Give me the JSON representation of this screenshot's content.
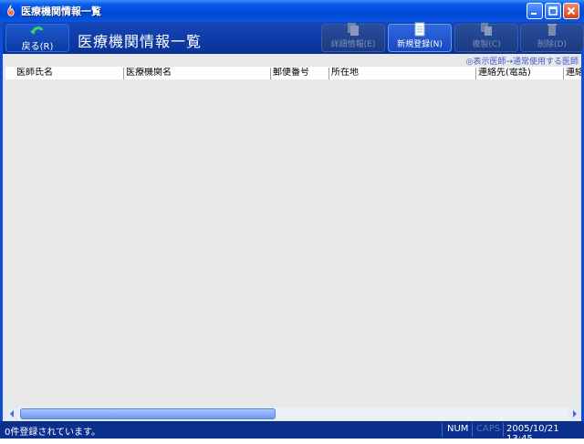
{
  "window": {
    "title": "医療機関情報一覧"
  },
  "toolbar": {
    "back_label": "戻る(R)",
    "page_title": "医療機関情報一覧",
    "details_label": "詳細情報(E)",
    "new_label": "新規登録(N)",
    "copy_label": "複製(C)",
    "delete_label": "削除(D)"
  },
  "note": "◎表示医師→通常使用する医師",
  "table": {
    "columns": [
      "医師氏名",
      "医療機関名",
      "郵便番号",
      "所在地",
      "連絡先(電話)",
      "連絡"
    ],
    "rows": []
  },
  "status": {
    "message": "0件登録されています。",
    "num": "NUM",
    "caps": "CAPS",
    "datetime": "2005/10/21 13:45"
  },
  "colors": {
    "titlebar": "#0048d8",
    "toolbar": "#0a3296",
    "statusbar": "#0a2f8c",
    "accent": "#3a5ad8"
  }
}
